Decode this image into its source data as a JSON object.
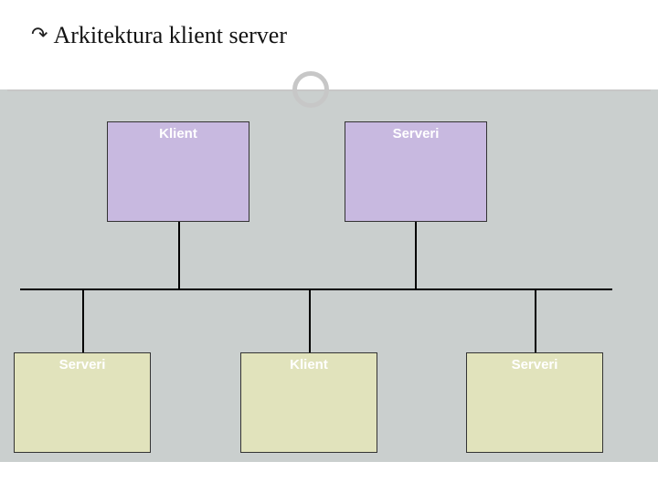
{
  "title": "Arkitektura klient server",
  "boxes": {
    "top_left": {
      "label": "Klient"
    },
    "top_right": {
      "label": "Serveri"
    },
    "bot_left": {
      "label": "Serveri"
    },
    "bot_mid": {
      "label": "Klient"
    },
    "bot_right": {
      "label": "Serveri"
    }
  }
}
